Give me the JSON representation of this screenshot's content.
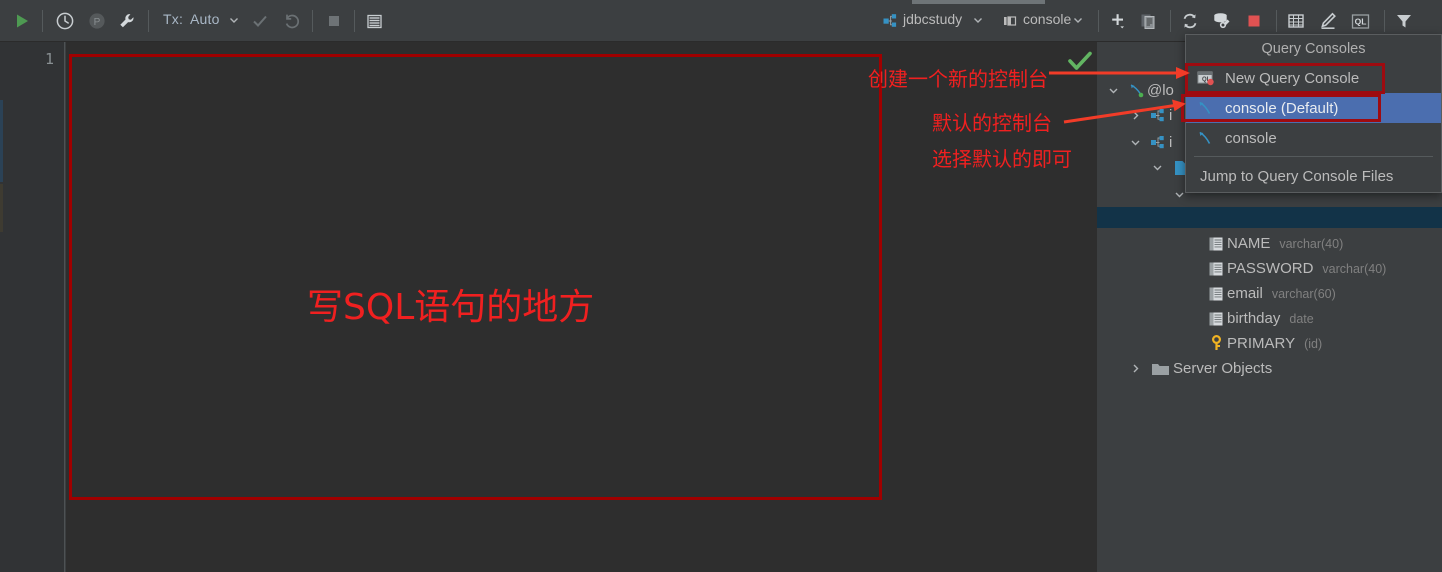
{
  "toolbar": {
    "run_icon": "run-play-icon",
    "history_icon": "history-clock-icon",
    "pause_icon": "pause-circle-icon",
    "wrench_icon": "wrench-icon",
    "tx_label": "Tx:",
    "tx_value": "Auto",
    "commit_icon": "commit-check-icon",
    "rollback_icon": "rollback-icon",
    "stop_icon": "stop-square-icon",
    "datasource_icon": "data-grid-icon",
    "schema_name": "jdbcstudy",
    "schema_icon": "database-schema-icon",
    "console_name": "console",
    "console_icon": "console-icon",
    "add_icon": "add-plus-icon",
    "copy_icon": "duplicate-icon",
    "refresh_icon": "refresh-sync-icon",
    "datasource_properties_icon": "datasource-properties-icon",
    "stop_red_icon": "stop-red-icon",
    "table_icon": "table-grid-icon",
    "edit_icon": "edit-pencil-icon",
    "ql_icon": "ql-icon",
    "filter_icon": "filter-funnel-icon"
  },
  "editor": {
    "line_number": "1",
    "sql_hint_text": "写SQL语句的地方",
    "ok_icon": "green-check-icon"
  },
  "menu": {
    "title": "Query Consoles",
    "items": [
      {
        "label": "New Query Console",
        "icon": "new-query-console-icon",
        "selected": false
      },
      {
        "label": "console (Default)",
        "icon": "console-file-icon",
        "selected": true
      },
      {
        "label": "console",
        "icon": "console-file-icon",
        "selected": false
      }
    ],
    "footer_item": {
      "label": "Jump to Query Console Files",
      "icon": "none"
    }
  },
  "tree": {
    "rows": [
      {
        "label": "@lo",
        "type": "",
        "indent": 0,
        "twisty": "down",
        "icon": "datasource-icon"
      },
      {
        "label": "i",
        "type": "",
        "indent": 1,
        "twisty": "right",
        "icon": "schema-icon"
      },
      {
        "label": "i",
        "type": "",
        "indent": 1,
        "twisty": "down",
        "icon": "schema-icon"
      },
      {
        "label": "",
        "type": "",
        "indent": 2,
        "twisty": "down",
        "icon": "table-file-icon"
      },
      {
        "label": "",
        "type": "",
        "indent": 3,
        "twisty": "down",
        "icon": "none"
      },
      {
        "label": "",
        "type": "",
        "indent": 3,
        "twisty": "none",
        "icon": "none"
      },
      {
        "label": "NAME",
        "type": "varchar(40)",
        "indent": 4,
        "twisty": "none",
        "icon": "column-icon"
      },
      {
        "label": "PASSWORD",
        "type": "varchar(40)",
        "indent": 4,
        "twisty": "none",
        "icon": "column-icon"
      },
      {
        "label": "email",
        "type": "varchar(60)",
        "indent": 4,
        "twisty": "none",
        "icon": "column-icon"
      },
      {
        "label": "birthday",
        "type": "date",
        "indent": 4,
        "twisty": "none",
        "icon": "column-icon"
      },
      {
        "label": "PRIMARY",
        "type": "(id)",
        "indent": 4,
        "twisty": "none",
        "icon": "primary-key-icon"
      },
      {
        "label": "Server Objects",
        "type": "",
        "indent": 1,
        "twisty": "right",
        "icon": "folder-icon"
      }
    ]
  },
  "annotations": {
    "line1": "创建一个新的控制台",
    "line2": "默认的控制台",
    "line3": "选择默认的即可"
  },
  "colors": {
    "panel_bg": "#3c3f41",
    "editor_bg": "#2e2e2e",
    "gutter_bg": "#313335",
    "annotation_red": "#f02020",
    "highlight_red": "#9e0b10",
    "selection_blue": "#4b6eaf",
    "tree_selection": "#123348",
    "text": "#bbbbbb",
    "muted_text": "#808080"
  }
}
